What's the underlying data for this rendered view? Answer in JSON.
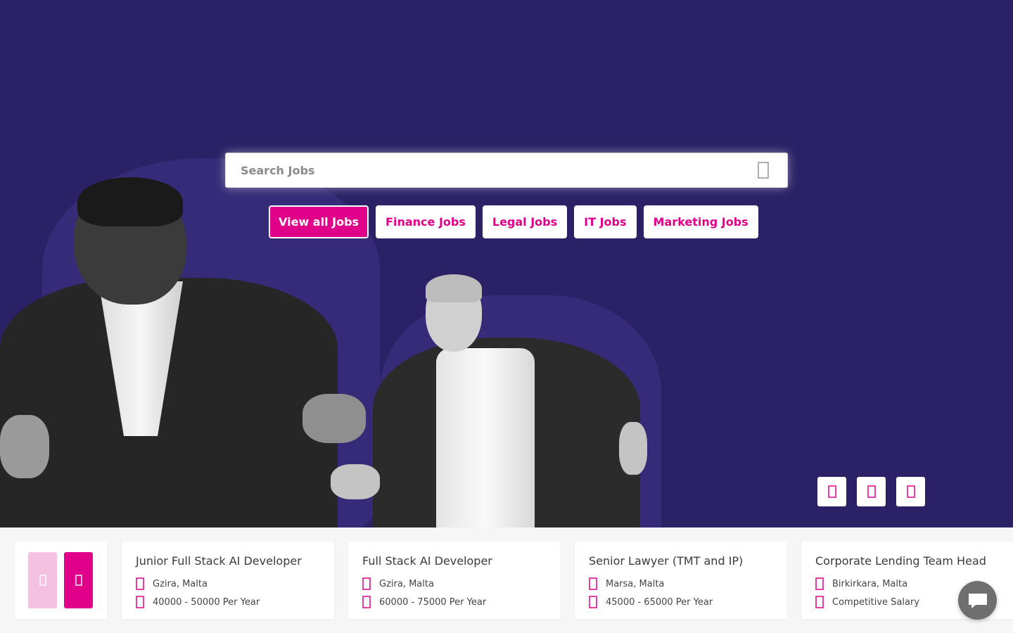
{
  "search": {
    "placeholder": "Search Jobs"
  },
  "quick_links": [
    {
      "label": "View all Jobs",
      "active": true
    },
    {
      "label": "Finance Jobs"
    },
    {
      "label": "Legal Jobs"
    },
    {
      "label": "IT Jobs"
    },
    {
      "label": "Marketing Jobs"
    }
  ],
  "hero_controls": [
    "user-icon",
    "briefcase-icon",
    "phone-icon"
  ],
  "jobs": [
    {
      "title": "Junior Full Stack AI Developer",
      "location": "Gzira, Malta",
      "salary": "40000 - 50000 Per Year"
    },
    {
      "title": "Full Stack AI Developer",
      "location": "Gzira, Malta",
      "salary": "60000 - 75000 Per Year"
    },
    {
      "title": "Senior Lawyer (TMT and IP)",
      "location": "Marsa, Malta",
      "salary": "45000 - 65000 Per Year"
    },
    {
      "title": "Corporate Lending Team Head",
      "location": "Birkirkara, Malta",
      "salary": "Competitive Salary"
    }
  ],
  "colors": {
    "hero_bg": "#2a2166",
    "accent": "#e0008a",
    "accent_light": "#f5c1e0",
    "chat_bg": "#6f6f6f"
  }
}
